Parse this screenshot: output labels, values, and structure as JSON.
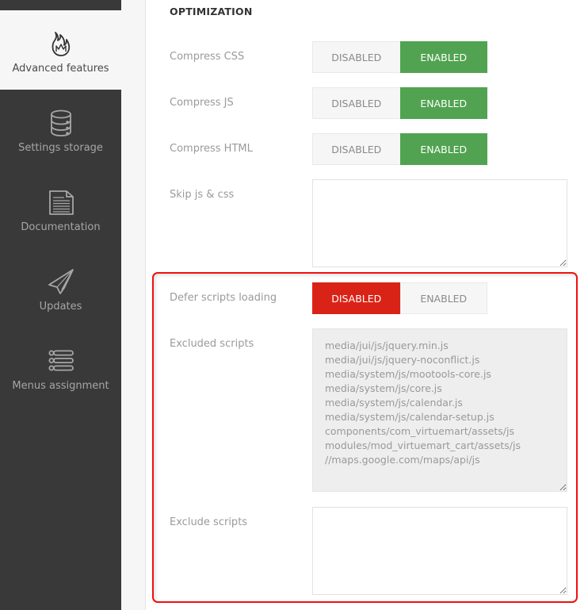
{
  "sidebar": {
    "items": [
      {
        "label": "Advanced features",
        "icon": "flame-icon",
        "active": true
      },
      {
        "label": "Settings storage",
        "icon": "database-icon",
        "active": false
      },
      {
        "label": "Documentation",
        "icon": "document-icon",
        "active": false
      },
      {
        "label": "Updates",
        "icon": "paper-plane-icon",
        "active": false
      },
      {
        "label": "Menus assignment",
        "icon": "list-icon",
        "active": false
      }
    ]
  },
  "section": {
    "title": "OPTIMIZATION"
  },
  "settings": {
    "compress_css": {
      "label": "Compress CSS",
      "disabled_label": "DISABLED",
      "enabled_label": "ENABLED",
      "value": "enabled"
    },
    "compress_js": {
      "label": "Compress JS",
      "disabled_label": "DISABLED",
      "enabled_label": "ENABLED",
      "value": "enabled"
    },
    "compress_html": {
      "label": "Compress HTML",
      "disabled_label": "DISABLED",
      "enabled_label": "ENABLED",
      "value": "enabled"
    },
    "skip_js_css": {
      "label": "Skip js & css",
      "value": ""
    },
    "defer_scripts": {
      "label": "Defer scripts loading",
      "disabled_label": "DISABLED",
      "enabled_label": "ENABLED",
      "value": "disabled"
    },
    "excluded_scripts": {
      "label": "Excluded scripts",
      "value": "media/jui/js/jquery.min.js\nmedia/jui/js/jquery-noconflict.js\nmedia/system/js/mootools-core.js\nmedia/system/js/core.js\nmedia/system/js/calendar.js\nmedia/system/js/calendar-setup.js\ncomponents/com_virtuemart/assets/js\nmodules/mod_virtuemart_cart/assets/js\n//maps.google.com/maps/api/js"
    },
    "exclude_scripts": {
      "label": "Exclude scripts",
      "value": ""
    }
  },
  "colors": {
    "sidebar_bg": "#393939",
    "enabled_green": "#51a351",
    "disabled_red": "#da2317",
    "highlight_red": "#f20f0f"
  }
}
